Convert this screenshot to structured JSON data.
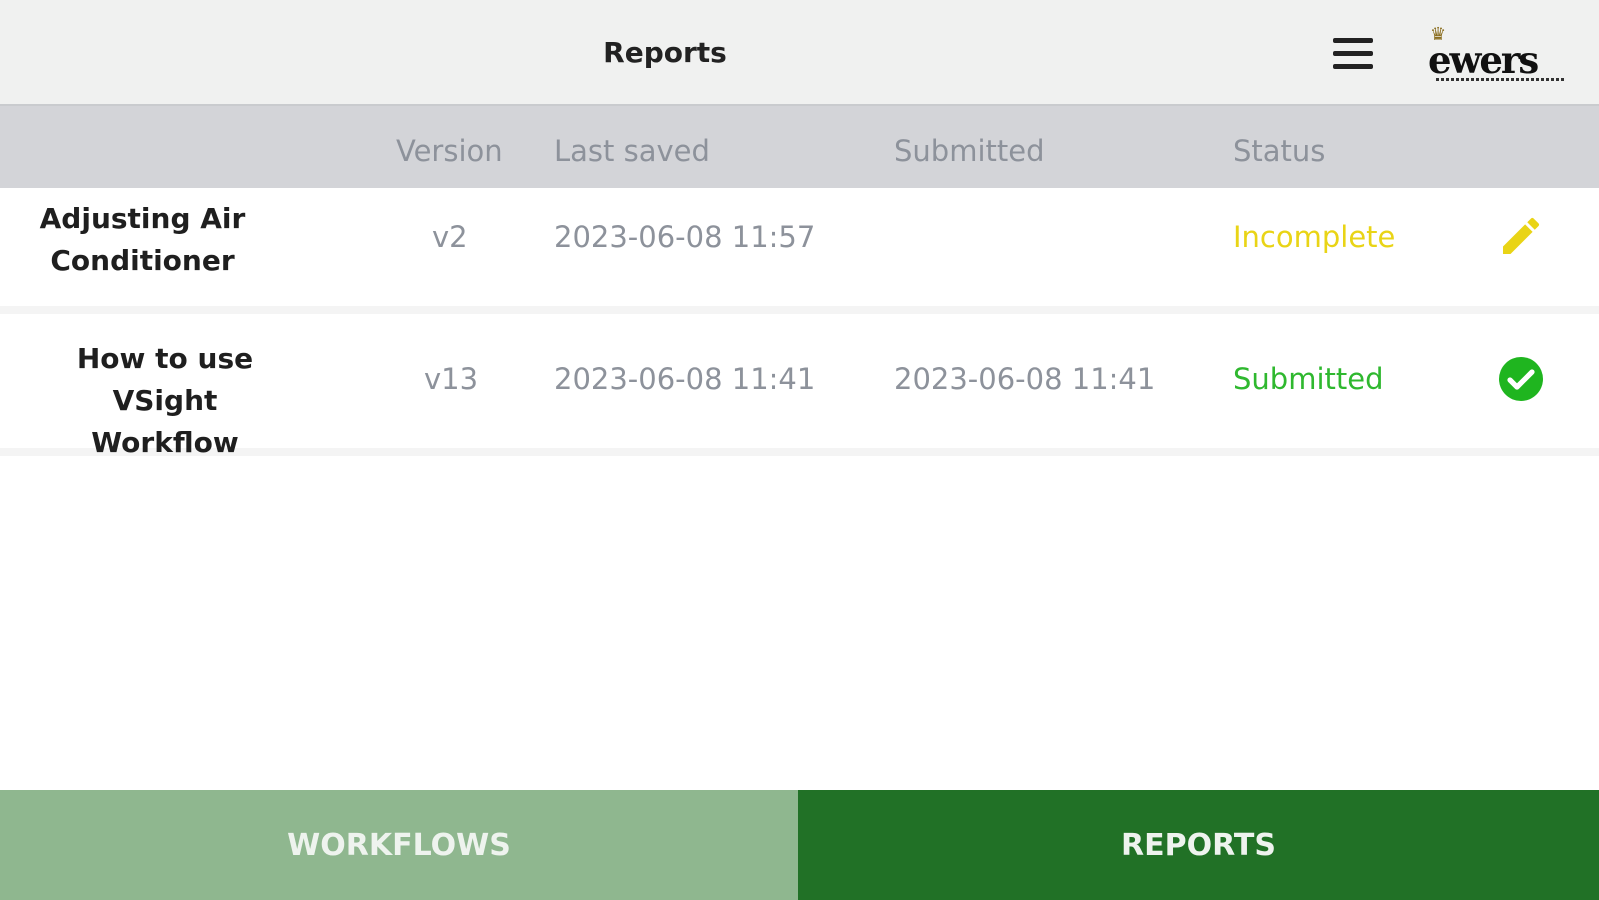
{
  "header": {
    "title": "Reports",
    "menu_icon": "hamburger-menu-icon",
    "logo_text": "ewers"
  },
  "table": {
    "columns": [
      "Version",
      "Last saved",
      "Submitted",
      "Status"
    ],
    "rows": [
      {
        "name_line1": "Adjusting Air",
        "name_line2": "Conditioner",
        "version": "v2",
        "last_saved": "2023-06-08 11:57",
        "submitted": "",
        "status": "Incomplete",
        "status_color": "#e9d416",
        "action_icon": "pencil-icon"
      },
      {
        "name_line1": "How to use",
        "name_line2": "VSight Workflow",
        "version": "v13",
        "last_saved": "2023-06-08 11:41",
        "submitted": "2023-06-08 11:41",
        "status": "Submitted",
        "status_color": "#2fb82f",
        "action_icon": "check-circle-icon"
      }
    ]
  },
  "nav": {
    "tabs": [
      {
        "label": "WORKFLOWS",
        "active": false
      },
      {
        "label": "REPORTS",
        "active": true
      }
    ]
  },
  "colors": {
    "accent_dark": "#217126",
    "accent_light": "#8fb78f",
    "incomplete": "#e9d416",
    "submitted": "#2fb82f"
  }
}
